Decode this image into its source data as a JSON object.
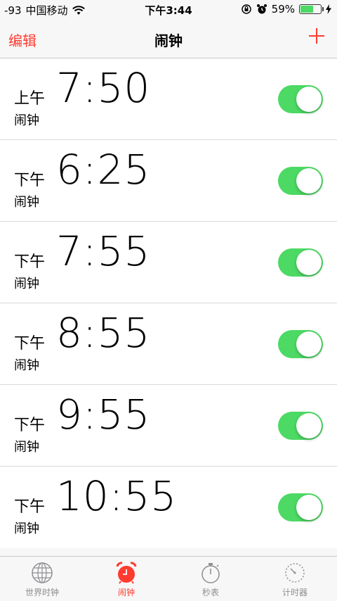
{
  "status_bar": {
    "signal": "-93",
    "carrier": "中国移动",
    "time": "下午3:44",
    "battery": "59%"
  },
  "nav": {
    "edit": "编辑",
    "title": "闹钟"
  },
  "alarms": [
    {
      "period": "上午",
      "time": "7:50",
      "label": "闹钟",
      "enabled": true
    },
    {
      "period": "下午",
      "time": "6:25",
      "label": "闹钟",
      "enabled": true
    },
    {
      "period": "下午",
      "time": "7:55",
      "label": "闹钟",
      "enabled": true
    },
    {
      "period": "下午",
      "time": "8:55",
      "label": "闹钟",
      "enabled": true
    },
    {
      "period": "下午",
      "time": "9:55",
      "label": "闹钟",
      "enabled": true
    },
    {
      "period": "下午",
      "time": "10:55",
      "label": "闹钟",
      "enabled": true
    }
  ],
  "tabs": [
    {
      "label": "世界时钟",
      "icon": "globe-icon",
      "active": false
    },
    {
      "label": "闹钟",
      "icon": "alarm-clock-icon",
      "active": true
    },
    {
      "label": "秒表",
      "icon": "stopwatch-icon",
      "active": false
    },
    {
      "label": "计时器",
      "icon": "timer-icon",
      "active": false
    }
  ],
  "colors": {
    "accent": "#ff3b30",
    "toggle_on": "#4cd964",
    "tab_inactive": "#8e8e93"
  }
}
